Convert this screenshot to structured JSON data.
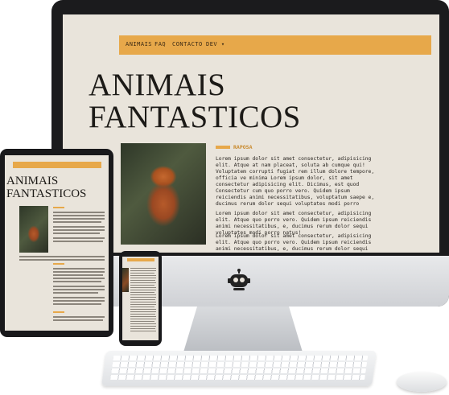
{
  "site": {
    "nav": [
      "ANIMAIS",
      "FAQ",
      "CONTACTO",
      "DEV"
    ],
    "nav_dropdown_glyph": "▾",
    "title_line1": "ANIMAIS",
    "title_line2": "FANTASTICOS",
    "section_label": "RAPOSA",
    "paragraphs": [
      "Lorem ipsum dolor sit amet consectetur, adipisicing elit. Atque at nam placeat, soluta ab cumque qui! Voluptatem corrupti fugiat rem illum dolore tempore, officia ve minima Lorem ipsum dolor, sit amet consectetur adipisicing elit. Dicimus, est quod Consectetur cum quo porro vero. Quidem ipsum reiciendis animi necessitatibus, voluptatum saepe e, ducimus rerum dolor sequi voluptates modi porro natus!",
      "Lorem ipsum dolor sit amet consectetur, adipisicing elit. Atque quo porro vero. Quidem ipsum reiciendis animi necessitatibus, e, ducimus rerum dolor sequi voluptates modi porro natus!",
      "Lorem ipsum dolor sit amet consectetur, adipisicing elit. Atque quo porro vero. Quidem ipsum reiciendis animi necessitatibus, e, ducimus rerum dolor sequi voluptates modi porro natus!"
    ]
  },
  "colors": {
    "accent": "#e7a84a",
    "page_bg": "#e9e4db",
    "text": "#1c1a17"
  },
  "devices": {
    "logo_icon": "robot-head-icon"
  }
}
